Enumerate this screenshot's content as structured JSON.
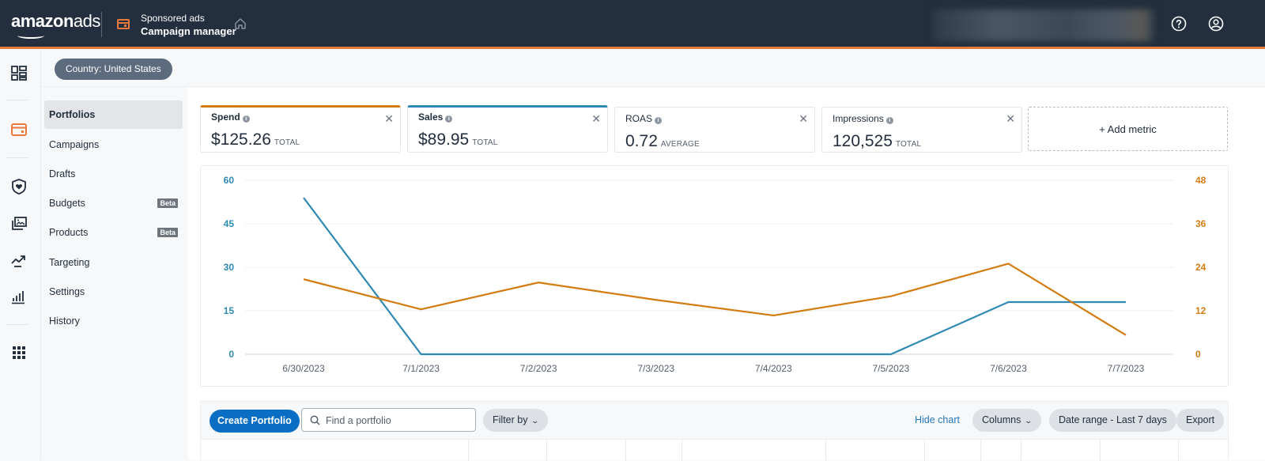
{
  "header": {
    "logo_bold": "amazon",
    "logo_light": "ads",
    "app_subtitle": "Sponsored ads",
    "app_title": "Campaign manager"
  },
  "country_selector": "Country: United States",
  "subnav": {
    "items": [
      {
        "label": "Portfolios",
        "active": true,
        "badge": ""
      },
      {
        "label": "Campaigns",
        "active": false,
        "badge": ""
      },
      {
        "label": "Drafts",
        "active": false,
        "badge": ""
      },
      {
        "label": "Budgets",
        "active": false,
        "badge": "Beta"
      },
      {
        "label": "Products",
        "active": false,
        "badge": "Beta"
      },
      {
        "label": "Targeting",
        "active": false,
        "badge": ""
      },
      {
        "label": "Settings",
        "active": false,
        "badge": ""
      },
      {
        "label": "History",
        "active": false,
        "badge": ""
      }
    ]
  },
  "rail_icons": [
    "dashboard-icon",
    "wallet-icon",
    "shield-heart-icon",
    "media-library-icon",
    "trending-icon",
    "bar-chart-icon",
    "apps-grid-icon"
  ],
  "metrics": [
    {
      "name": "Spend",
      "value": "$125.26",
      "suffix": "TOTAL",
      "color": "#d37c10"
    },
    {
      "name": "Sales",
      "value": "$89.95",
      "suffix": "TOTAL",
      "color": "#2f8ab3"
    },
    {
      "name": "ROAS",
      "value": "0.72",
      "suffix": "AVERAGE",
      "color": ""
    },
    {
      "name": "Impressions",
      "value": "120,525",
      "suffix": "TOTAL",
      "color": ""
    }
  ],
  "add_metric_label": "+ Add metric",
  "chart_data": {
    "type": "line",
    "categories": [
      "6/30/2023",
      "7/1/2023",
      "7/2/2023",
      "7/3/2023",
      "7/4/2023",
      "7/5/2023",
      "7/6/2023",
      "7/7/2023"
    ],
    "series": [
      {
        "name": "Sales",
        "axis": "left",
        "color": "#2f8ab3",
        "values": [
          54,
          0,
          0,
          0,
          0,
          0,
          18,
          18
        ]
      },
      {
        "name": "Spend",
        "axis": "right",
        "color": "#d37c10",
        "values": [
          20.7,
          12.4,
          19.8,
          15.0,
          10.7,
          16.0,
          25.0,
          5.3
        ]
      }
    ],
    "left_axis": {
      "ticks": [
        0,
        15,
        30,
        45,
        60
      ],
      "ylim": [
        0,
        60
      ],
      "color": "#2f8ab3"
    },
    "right_axis": {
      "ticks": [
        0,
        12,
        24,
        36,
        48
      ],
      "ylim": [
        0,
        48
      ],
      "color": "#d37c10"
    },
    "grid": true,
    "title": "",
    "xlabel": "",
    "ylabel": ""
  },
  "toolbar": {
    "create_label": "Create Portfolio",
    "search_placeholder": "Find a portfolio",
    "filter_label": "Filter by",
    "hide_chart_label": "Hide chart",
    "columns_label": "Columns",
    "date_range_label": "Date range - Last 7 days",
    "export_label": "Export"
  }
}
